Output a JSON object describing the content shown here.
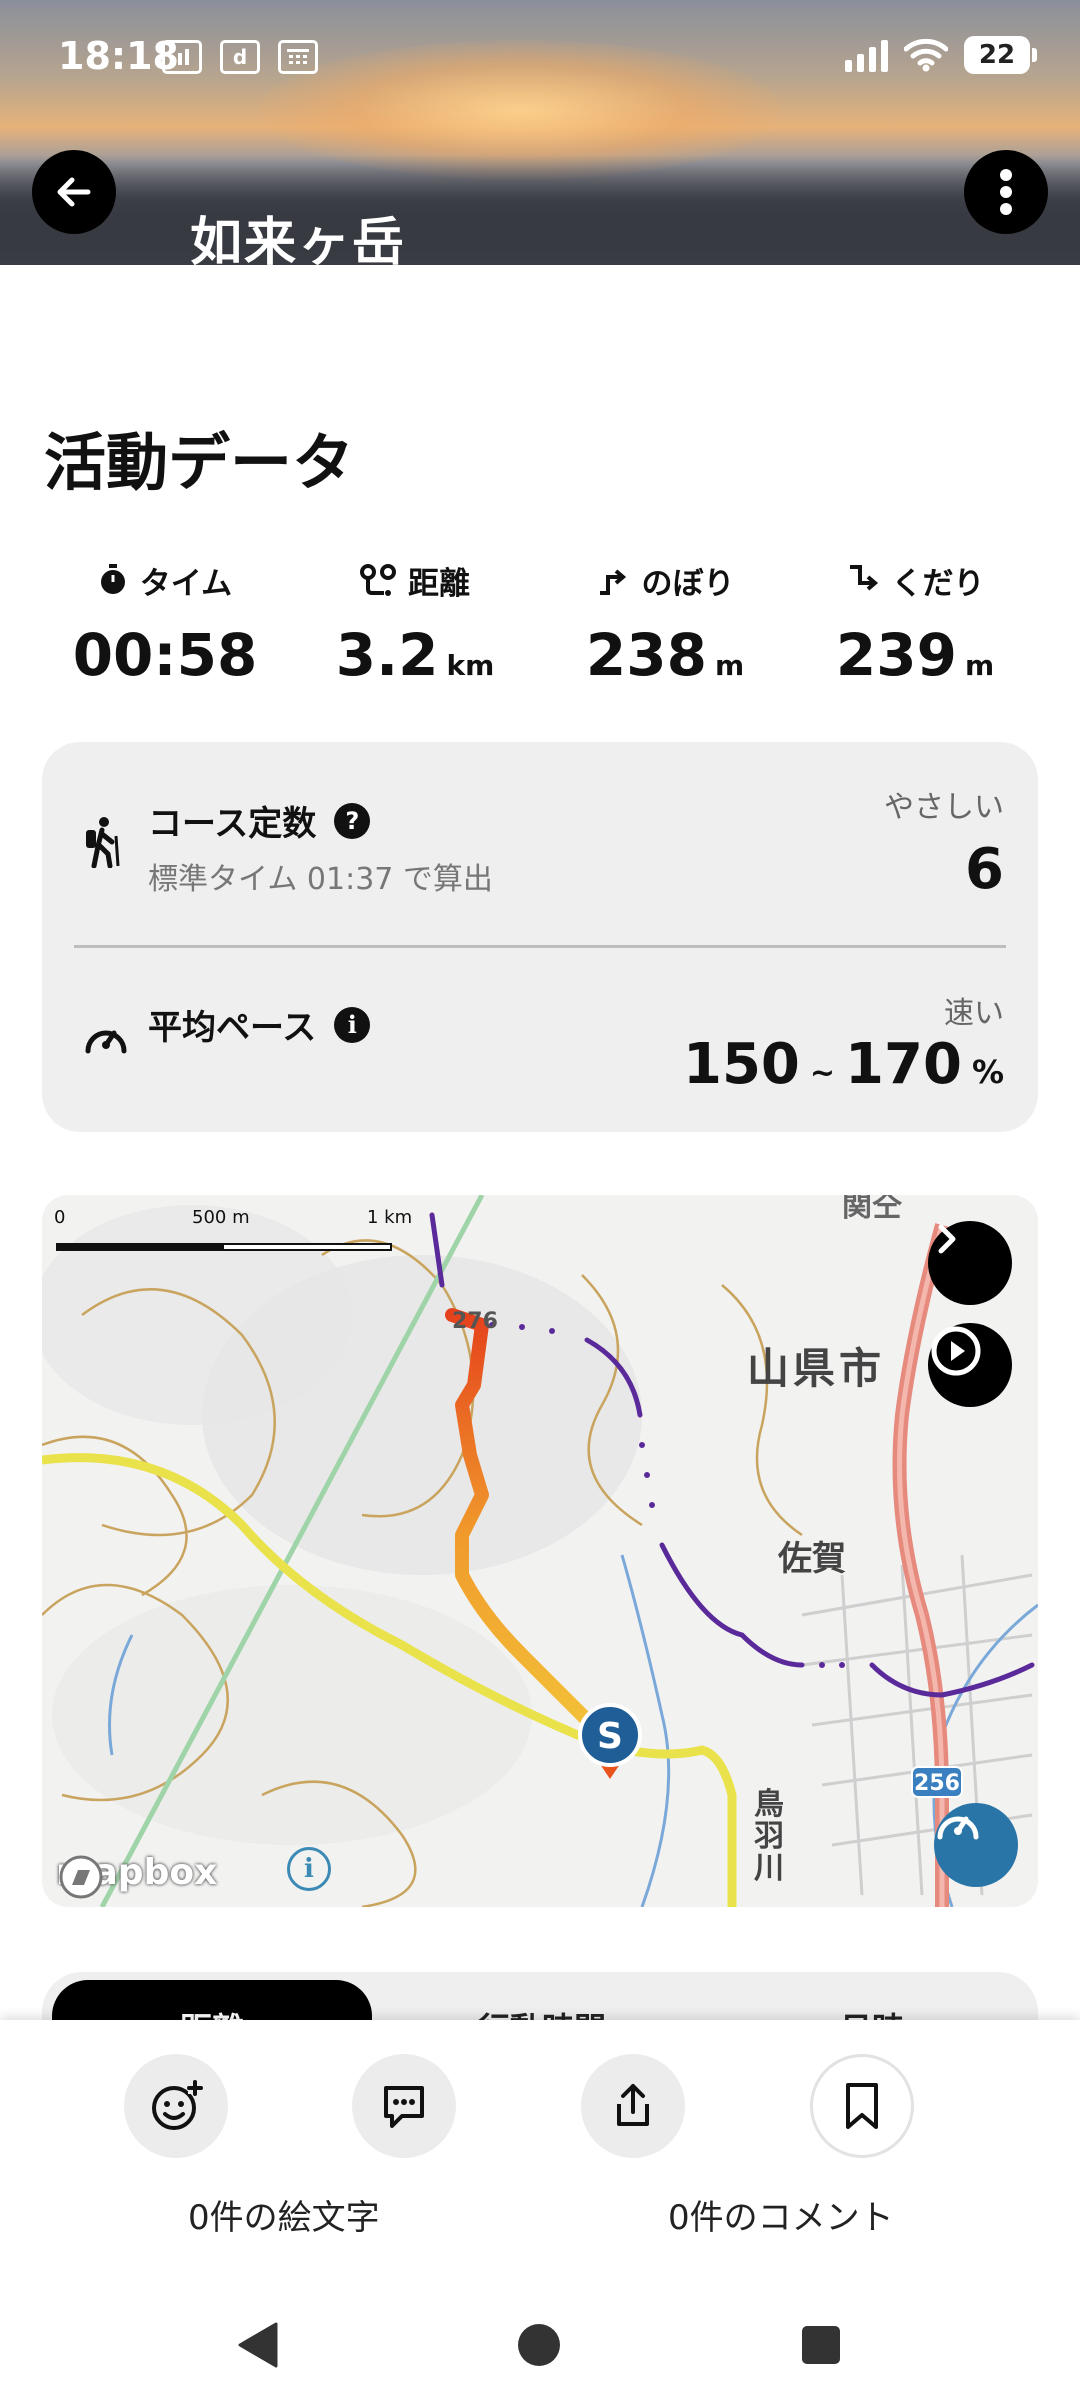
{
  "status_bar": {
    "time": "18:18",
    "battery": "22",
    "icons": [
      "gallery-icon",
      "d-icon",
      "calendar-icon",
      "signal-icon",
      "wifi-icon",
      "battery-icon"
    ]
  },
  "header": {
    "title": "如来ヶ岳"
  },
  "activity": {
    "section_title": "活動データ",
    "stats": [
      {
        "label": "タイム",
        "value": "00:58",
        "unit": ""
      },
      {
        "label": "距離",
        "value": "3.2",
        "unit": "km"
      },
      {
        "label": "のぼり",
        "value": "238",
        "unit": "m"
      },
      {
        "label": "くだり",
        "value": "239",
        "unit": "m"
      }
    ]
  },
  "course": {
    "title": "コース定数",
    "help_icon": "?",
    "subtitle": "標準タイム 01:37 で算出",
    "difficulty": "やさしい",
    "value": "6",
    "pace_title": "平均ペース",
    "info_icon": "i",
    "pace_rating": "速い",
    "pace_min": "150",
    "pace_sep": "~",
    "pace_max": "170",
    "pace_unit": "%"
  },
  "map": {
    "scale": [
      "0",
      "500 m",
      "1 km"
    ],
    "labels": {
      "city": "山県市",
      "saga": "佐賀",
      "river1": "鳥",
      "river2": "羽",
      "river3": "川",
      "route_num": "256",
      "peak": "276",
      "top": "関仝"
    },
    "start_marker": "S",
    "attribution": "mapbox",
    "info": "i"
  },
  "tabs": [
    "距離",
    "行動時間",
    "日時"
  ],
  "footer": {
    "emoji_count": "0件の絵文字",
    "comment_count": "0件のコメント"
  },
  "colors": {
    "accent_blue": "#2a75a8",
    "route_start": "#f2c23a",
    "route_end": "#e8541b",
    "card_bg": "#efefef"
  }
}
